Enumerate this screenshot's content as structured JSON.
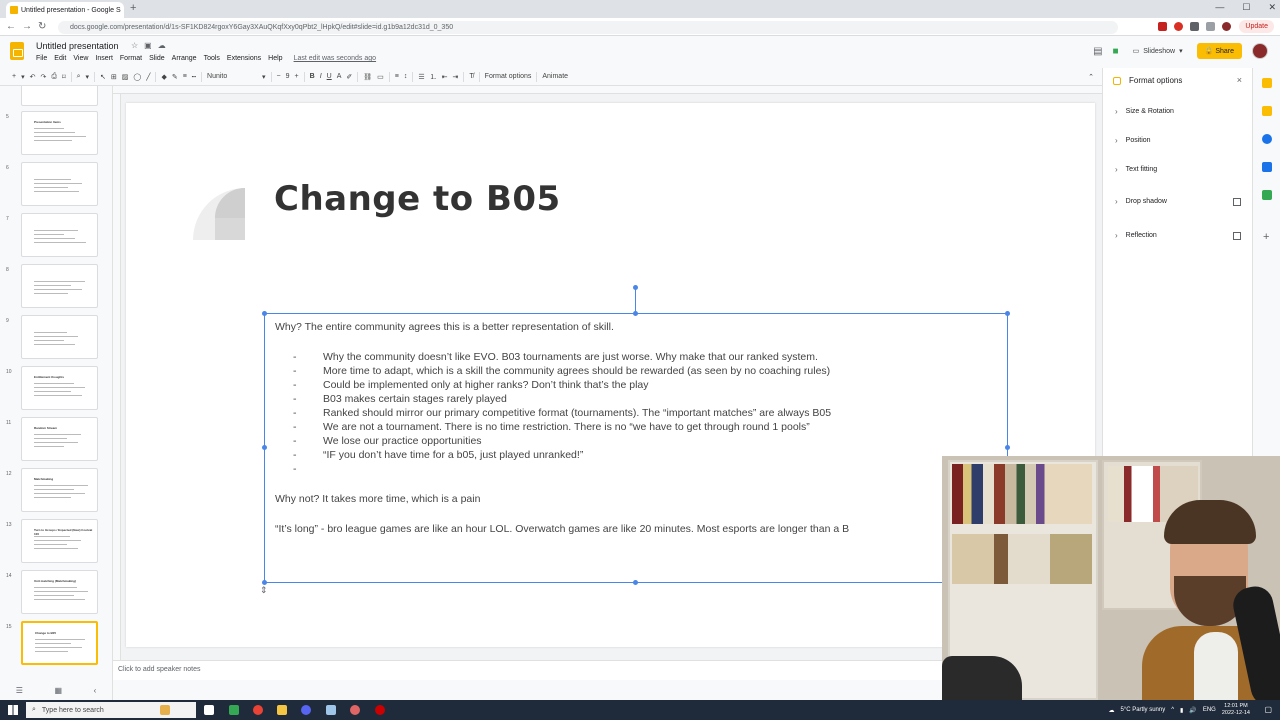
{
  "browser": {
    "tab_title": "Untitled presentation - Google S",
    "tab_close": "×",
    "new_tab": "+",
    "url": "docs.google.com/presentation/d/1s-SF1KD824rgoxY6Gay3XAuQKqfXxy0qPbt2_lHpkQ/edit#slide=id.g1b9a12dc31d_0_350",
    "update_label": "Update"
  },
  "app": {
    "title": "Untitled presentation",
    "menu": [
      "File",
      "Edit",
      "View",
      "Insert",
      "Format",
      "Slide",
      "Arrange",
      "Tools",
      "Extensions",
      "Help"
    ],
    "last_edit": "Last edit was seconds ago",
    "slideshow_label": "Slideshow",
    "share_label": "Share"
  },
  "toolbar": {
    "font": "Nunito",
    "font_size": "9",
    "format_options": "Format options",
    "animate": "Animate"
  },
  "filmstrip": {
    "slides": [
      {
        "num": "5",
        "title": "Presentation Items"
      },
      {
        "num": "6",
        "title": ""
      },
      {
        "num": "7",
        "title": ""
      },
      {
        "num": "8",
        "title": ""
      },
      {
        "num": "9",
        "title": ""
      },
      {
        "num": "10",
        "title": "Entitlement thoughts"
      },
      {
        "num": "11",
        "title": "Random Stream"
      },
      {
        "num": "12",
        "title": "Matchmaking"
      },
      {
        "num": "13",
        "title": "Turn to Groups / Expected (New) Coolcat 100"
      },
      {
        "num": "14",
        "title": "Unit matching (Matchmaking)"
      },
      {
        "num": "15",
        "title": "Change to B05"
      }
    ]
  },
  "slide": {
    "title": "Change to B05",
    "intro": "Why? The entire community agrees this is a better representation of skill.",
    "bullets": [
      "Why the community doesn’t like EVO. B03 tournaments are just worse. Why make that our ranked system.",
      "More time to adapt, which is a skill the community agrees should be rewarded (as seen by no coaching rules)",
      "Could be implemented only at higher ranks? Don’t think that’s the play",
      "B03 makes certain stages rarely played",
      "Ranked should mirror our primary competitive format (tournaments). The “important matches” are always B05",
      "We are not a tournament. There is no time restriction. There is no “we have to get through round 1 pools”",
      "We lose our practice opportunities",
      "“IF you don’t have time for a b05, just played unranked!”",
      ""
    ],
    "bullet_dash": "-",
    "why_not": "Why not? It takes more time, which is a pain",
    "its_long": "“It’s long” - bro league games are like an hour LOL. Overwatch games are like 20 minutes. Most esports are longer than a B"
  },
  "speaker_notes_placeholder": "Click to add speaker notes",
  "format_panel": {
    "title": "Format options",
    "close": "×",
    "items": [
      {
        "label": "Size & Rotation",
        "checkbox": false
      },
      {
        "label": "Position",
        "checkbox": false
      },
      {
        "label": "Text fitting",
        "checkbox": false
      },
      {
        "label": "Drop shadow",
        "checkbox": true
      },
      {
        "label": "Reflection",
        "checkbox": true
      }
    ]
  },
  "taskbar": {
    "search_placeholder": "Type here to search",
    "weather": "5°C  Partly sunny",
    "lang": "ENG",
    "time": "12:01 PM",
    "date": "2022-12-14"
  },
  "colors": {
    "accent": "#fbbc04",
    "selection": "#4a86e8",
    "slides_brand": "#f4b400"
  }
}
